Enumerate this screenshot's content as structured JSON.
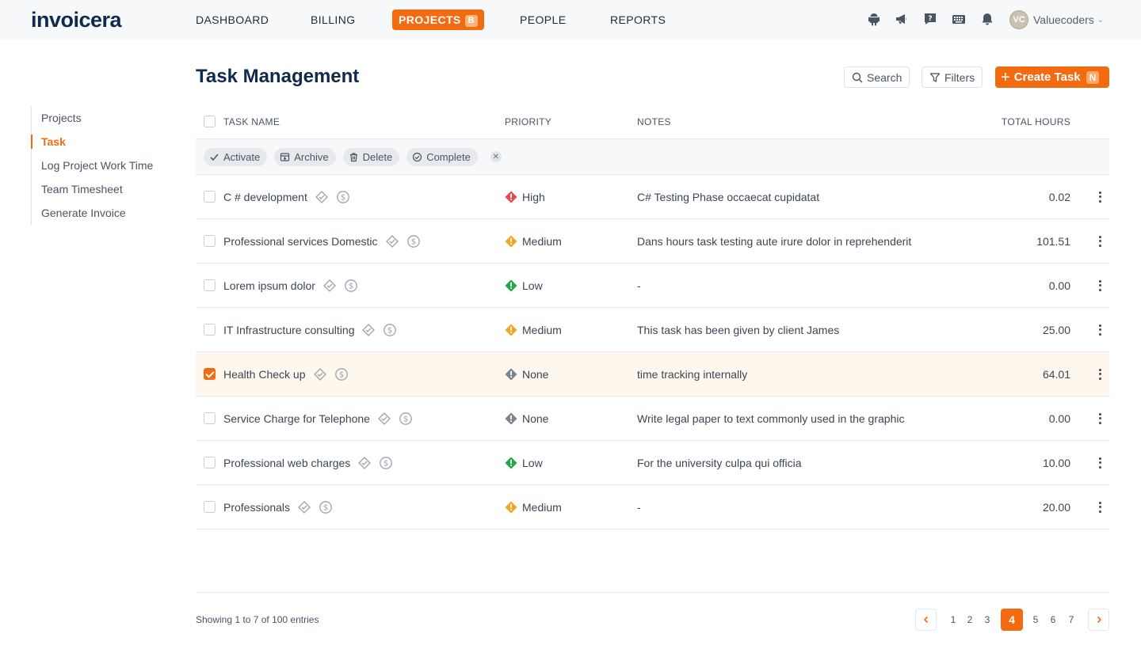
{
  "brand": {
    "logo_text": "invoicera",
    "accent": "#f26b10"
  },
  "topnav": {
    "items": [
      {
        "label": "DASHBOARD"
      },
      {
        "label": "BILLING"
      },
      {
        "label": "PROJECTS",
        "badge": "B",
        "active": true
      },
      {
        "label": "PEOPLE"
      },
      {
        "label": "REPORTS"
      }
    ],
    "icons": [
      "android-icon",
      "megaphone-icon",
      "help-icon",
      "keyboard-icon",
      "bell-icon"
    ],
    "user": {
      "initials": "VC",
      "name": "Valuecoders"
    }
  },
  "sidebar": {
    "items": [
      {
        "label": "Projects"
      },
      {
        "label": "Task",
        "active": true
      },
      {
        "label": "Log Project Work Time"
      },
      {
        "label": "Team Timesheet"
      },
      {
        "label": "Generate Invoice"
      }
    ]
  },
  "header": {
    "title": "Task Management",
    "search_label": "Search",
    "filters_label": "Filters",
    "create_label": "Create Task",
    "create_shortcut": "N"
  },
  "table": {
    "columns": {
      "name": "TASK NAME",
      "priority": "PRIORITY",
      "notes": "NOTES",
      "hours": "TOTAL HOURS"
    },
    "bulk_actions": [
      "Activate",
      "Archive",
      "Delete",
      "Complete"
    ],
    "priority_colors": {
      "High": "#e5484d",
      "Medium": "#f5a524",
      "Low": "#22a447",
      "None": "#7b838c"
    },
    "rows": [
      {
        "name": "C # development",
        "priority": "High",
        "notes": "C# Testing Phase occaecat cupidatat",
        "hours": "0.02",
        "selected": false
      },
      {
        "name": "Professional services Domestic",
        "priority": "Medium",
        "notes": "Dans hours task testing aute irure dolor in reprehenderit",
        "hours": "101.51",
        "selected": false
      },
      {
        "name": "Lorem ipsum dolor",
        "priority": "Low",
        "notes": "-",
        "hours": "0.00",
        "selected": false
      },
      {
        "name": "IT Infrastructure consulting",
        "priority": "Medium",
        "notes": "This task has been given by client James",
        "hours": "25.00",
        "selected": false
      },
      {
        "name": "Health Check up",
        "priority": "None",
        "notes": "time tracking internally",
        "hours": "64.01",
        "selected": true
      },
      {
        "name": "Service Charge for Telephone",
        "priority": "None",
        "notes": "Write legal paper to text commonly used in the graphic",
        "hours": "0.00",
        "selected": false
      },
      {
        "name": "Professional web charges",
        "priority": "Low",
        "notes": "For the university culpa qui officia",
        "hours": "10.00",
        "selected": false
      },
      {
        "name": "Professionals",
        "priority": "Medium",
        "notes": "-",
        "hours": "20.00",
        "selected": false
      }
    ]
  },
  "footer": {
    "showing_text": "Showing 1 to 7 of 100 entries",
    "pages": [
      "1",
      "2",
      "3",
      "4",
      "5",
      "6",
      "7"
    ],
    "current_page": "4"
  }
}
